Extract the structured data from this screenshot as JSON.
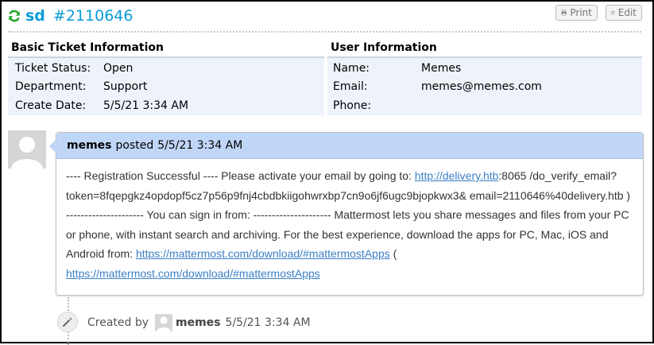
{
  "ticket": {
    "subject": "sd",
    "number": "#2110646"
  },
  "toolbar": {
    "print_label": "Print",
    "edit_label": "Edit"
  },
  "basic_info": {
    "title": "Basic Ticket Information",
    "rows": [
      {
        "label": "Ticket Status:",
        "value": "Open"
      },
      {
        "label": "Department:",
        "value": "Support"
      },
      {
        "label": "Create Date:",
        "value": "5/5/21 3:34 AM"
      }
    ]
  },
  "user_info": {
    "title": "User Information",
    "rows": [
      {
        "label": "Name:",
        "value": "Memes"
      },
      {
        "label": "Email:",
        "value": "memes@memes.com"
      },
      {
        "label": "Phone:",
        "value": ""
      }
    ]
  },
  "thread": {
    "poster": "memes",
    "posted_label": "posted",
    "posted_time": "5/5/21 3:34 AM",
    "body": {
      "t1": "---- Registration Successful ---- Please activate your email by going to: ",
      "link1": "http://delivery.htb",
      "t2": ":8065 /do_verify_email?token=8fqepgkz4opdopf5cz7p56p9fnj4cbdbkiigohwrxbp7cn9o6jf6ugc9bjopkwx3& email=2110646%40delivery.htb ) --------------------- You can sign in from: --------------------- Mattermost lets you share messages and files from your PC or phone, with instant search and archiving. For the best experience, download the apps for PC, Mac, iOS and Android from: ",
      "link2": "https://mattermost.com/download/#mattermostApps",
      "t3": " ( ",
      "link3": "https://mattermost.com/download/#mattermostApps"
    }
  },
  "event": {
    "created_label": "Created by",
    "user": "memes",
    "time": "5/5/21 3:34 AM"
  },
  "colors": {
    "accent": "#0a9cd6",
    "refresh": "#2aa52a",
    "header_bg": "#c0d6f7",
    "info_bg": "#eef3fb",
    "link": "#3b7fc4"
  }
}
